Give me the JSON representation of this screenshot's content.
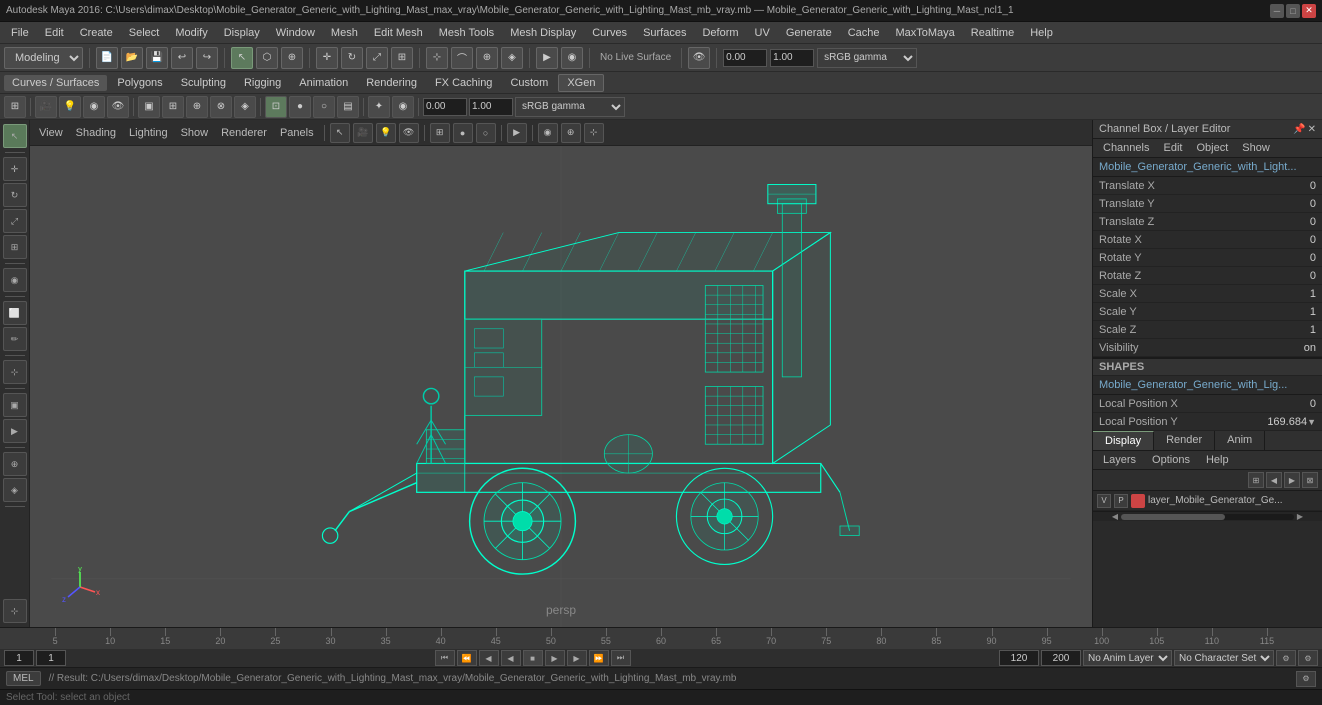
{
  "titlebar": {
    "title": "Autodesk Maya 2016: C:\\Users\\dimax\\Desktop\\Mobile_Generator_Generic_with_Lighting_Mast_max_vray\\Mobile_Generator_Generic_with_Lighting_Mast_mb_vray.mb — Mobile_Generator_Generic_with_Lighting_Mast_ncl1_1",
    "min": "─",
    "max": "□",
    "close": "✕"
  },
  "menubar": {
    "items": [
      "File",
      "Edit",
      "Create",
      "Select",
      "Modify",
      "Display",
      "Window",
      "Mesh",
      "Edit Mesh",
      "Mesh Tools",
      "Mesh Display",
      "Curves",
      "Surfaces",
      "Deform",
      "UV",
      "Generate",
      "Cache",
      "MaxToMaya",
      "Realtime",
      "Help"
    ]
  },
  "toolbar1": {
    "mode_dropdown": "Modeling",
    "fields": {
      "gamma": "sRGB gamma",
      "value1": "0.00",
      "value2": "1.00"
    }
  },
  "secondmenu": {
    "items": [
      "Curves / Surfaces",
      "Polygons",
      "Sculpting",
      "Rigging",
      "Animation",
      "Rendering",
      "FX Caching",
      "Custom",
      "XGen"
    ]
  },
  "viewport": {
    "menus": [
      "View",
      "Shading",
      "Lighting",
      "Show",
      "Renderer",
      "Panels"
    ],
    "camera": "persp"
  },
  "channel_box": {
    "title": "Channel Box / Layer Editor",
    "menus": [
      "Channels",
      "Edit",
      "Object",
      "Show"
    ],
    "object_name": "Mobile_Generator_Generic_with_Light...",
    "attributes": [
      {
        "label": "Translate X",
        "value": "0"
      },
      {
        "label": "Translate Y",
        "value": "0"
      },
      {
        "label": "Translate Z",
        "value": "0"
      },
      {
        "label": "Rotate X",
        "value": "0"
      },
      {
        "label": "Rotate Y",
        "value": "0"
      },
      {
        "label": "Rotate Z",
        "value": "0"
      },
      {
        "label": "Scale X",
        "value": "1"
      },
      {
        "label": "Scale Y",
        "value": "1"
      },
      {
        "label": "Scale Z",
        "value": "1"
      },
      {
        "label": "Visibility",
        "value": "on"
      }
    ],
    "shapes_label": "SHAPES",
    "shapes_name": "Mobile_Generator_Generic_with_Lig...",
    "local_pos_x": {
      "label": "Local Position X",
      "value": "0"
    },
    "local_pos_y": {
      "label": "Local Position Y",
      "value": "169.684"
    },
    "tabs": [
      "Display",
      "Render",
      "Anim"
    ],
    "active_tab": "Display",
    "layers_menus": [
      "Layers",
      "Options",
      "Help"
    ],
    "layer": {
      "v": "V",
      "p": "P",
      "name": "layer_Mobile_Generator_Ge..."
    }
  },
  "timeline": {
    "ticks": [
      "5",
      "10",
      "15",
      "20",
      "25",
      "30",
      "35",
      "40",
      "45",
      "50",
      "55",
      "60",
      "65",
      "70",
      "75",
      "80",
      "85",
      "90",
      "95",
      "100",
      "105",
      "110",
      "115"
    ],
    "start": "1",
    "end": "120",
    "anim_end": "120",
    "range_end": "200",
    "frame_current": "1",
    "playback_start": "1",
    "anim_layer": "No Anim Layer",
    "char_set": "No Character Set"
  },
  "statusbar": {
    "mel_label": "MEL",
    "result_text": "// Result: C:/Users/dimax/Desktop/Mobile_Generator_Generic_with_Lighting_Mast_max_vray/Mobile_Generator_Generic_with_Lighting_Mast_mb_vray.mb",
    "tool_help": "Select Tool: select an object"
  },
  "icons": {
    "transform": "⊞",
    "select": "↖",
    "move": "✛",
    "rotate": "↻",
    "scale": "⤢",
    "snap_grid": "⊹",
    "snap_curve": "⌒",
    "snap_point": "⊕",
    "history": "↩",
    "redo": "↪",
    "left_arrow": "◀",
    "right_arrow": "▶",
    "play": "▶",
    "stop": "■",
    "prev_frame": "|◀",
    "next_frame": "▶|",
    "skip_back": "◀◀",
    "skip_fwd": "▶▶"
  }
}
